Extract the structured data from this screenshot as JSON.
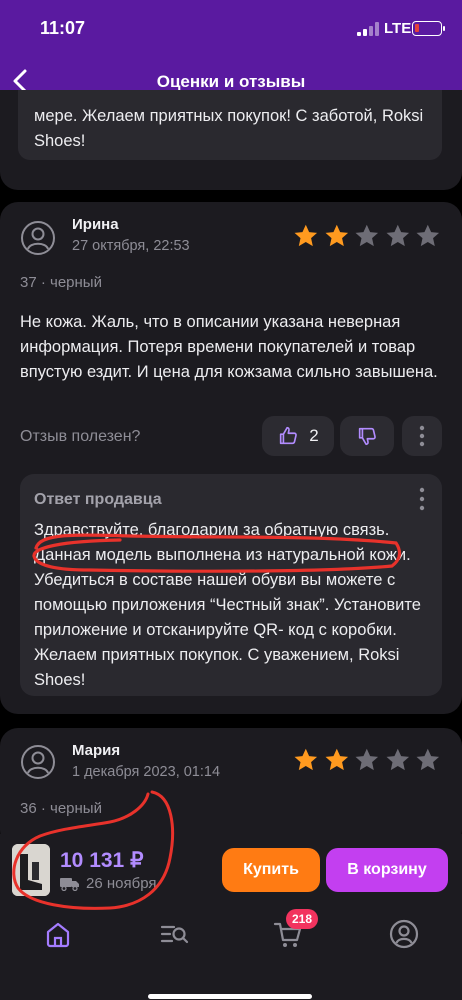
{
  "status_bar": {
    "time": "11:07",
    "network": "LTE"
  },
  "header": {
    "title": "Оценки и отзывы"
  },
  "previous_reply": {
    "text": "мере. Желаем приятных покупок! С заботой, Roksi Shoes!"
  },
  "reviews": [
    {
      "author": "Ирина",
      "date": "27 октября, 22:53",
      "rating": 2,
      "max_rating": 5,
      "variant": "37 · черный",
      "text": "Не кожа. Жаль, что в описании указана неверная информация. Потеря времени покупателей и товар впустую ездит. И цена для кожзама сильно завышена.",
      "helpful_label": "Отзыв полезен?",
      "likes": "2",
      "seller_reply": {
        "title": "Ответ продавца",
        "text": "Здравствуйте, благодарим за обратную связь. Данная модель выполнена из натуральной кожи. Убедиться в составе нашей обуви вы можете с помощью приложения “Честный знак”. Установите приложение и отсканируйте QR- код с коробки. Желаем приятных покупок. С уважением, Roksi Shoes!"
      }
    },
    {
      "author": "Мария",
      "date": "1 декабря 2023, 01:14",
      "rating": 2,
      "max_rating": 5,
      "variant": "36 · черный"
    }
  ],
  "buy_bar": {
    "price": "10 131 ₽",
    "delivery": "26 ноября",
    "buy_label": "Купить",
    "cart_label": "В корзину"
  },
  "tab_bar": {
    "cart_badge": "218"
  },
  "colors": {
    "header_bg": "#5a1aa0",
    "star_filled": "#ff9a1f",
    "star_empty": "#6e6d76",
    "price": "#b28cff",
    "buy_button": "#ff7b13",
    "cart_button": "#c33ff0",
    "badge": "#f2335e",
    "annotation_ink": "#e8322b"
  }
}
